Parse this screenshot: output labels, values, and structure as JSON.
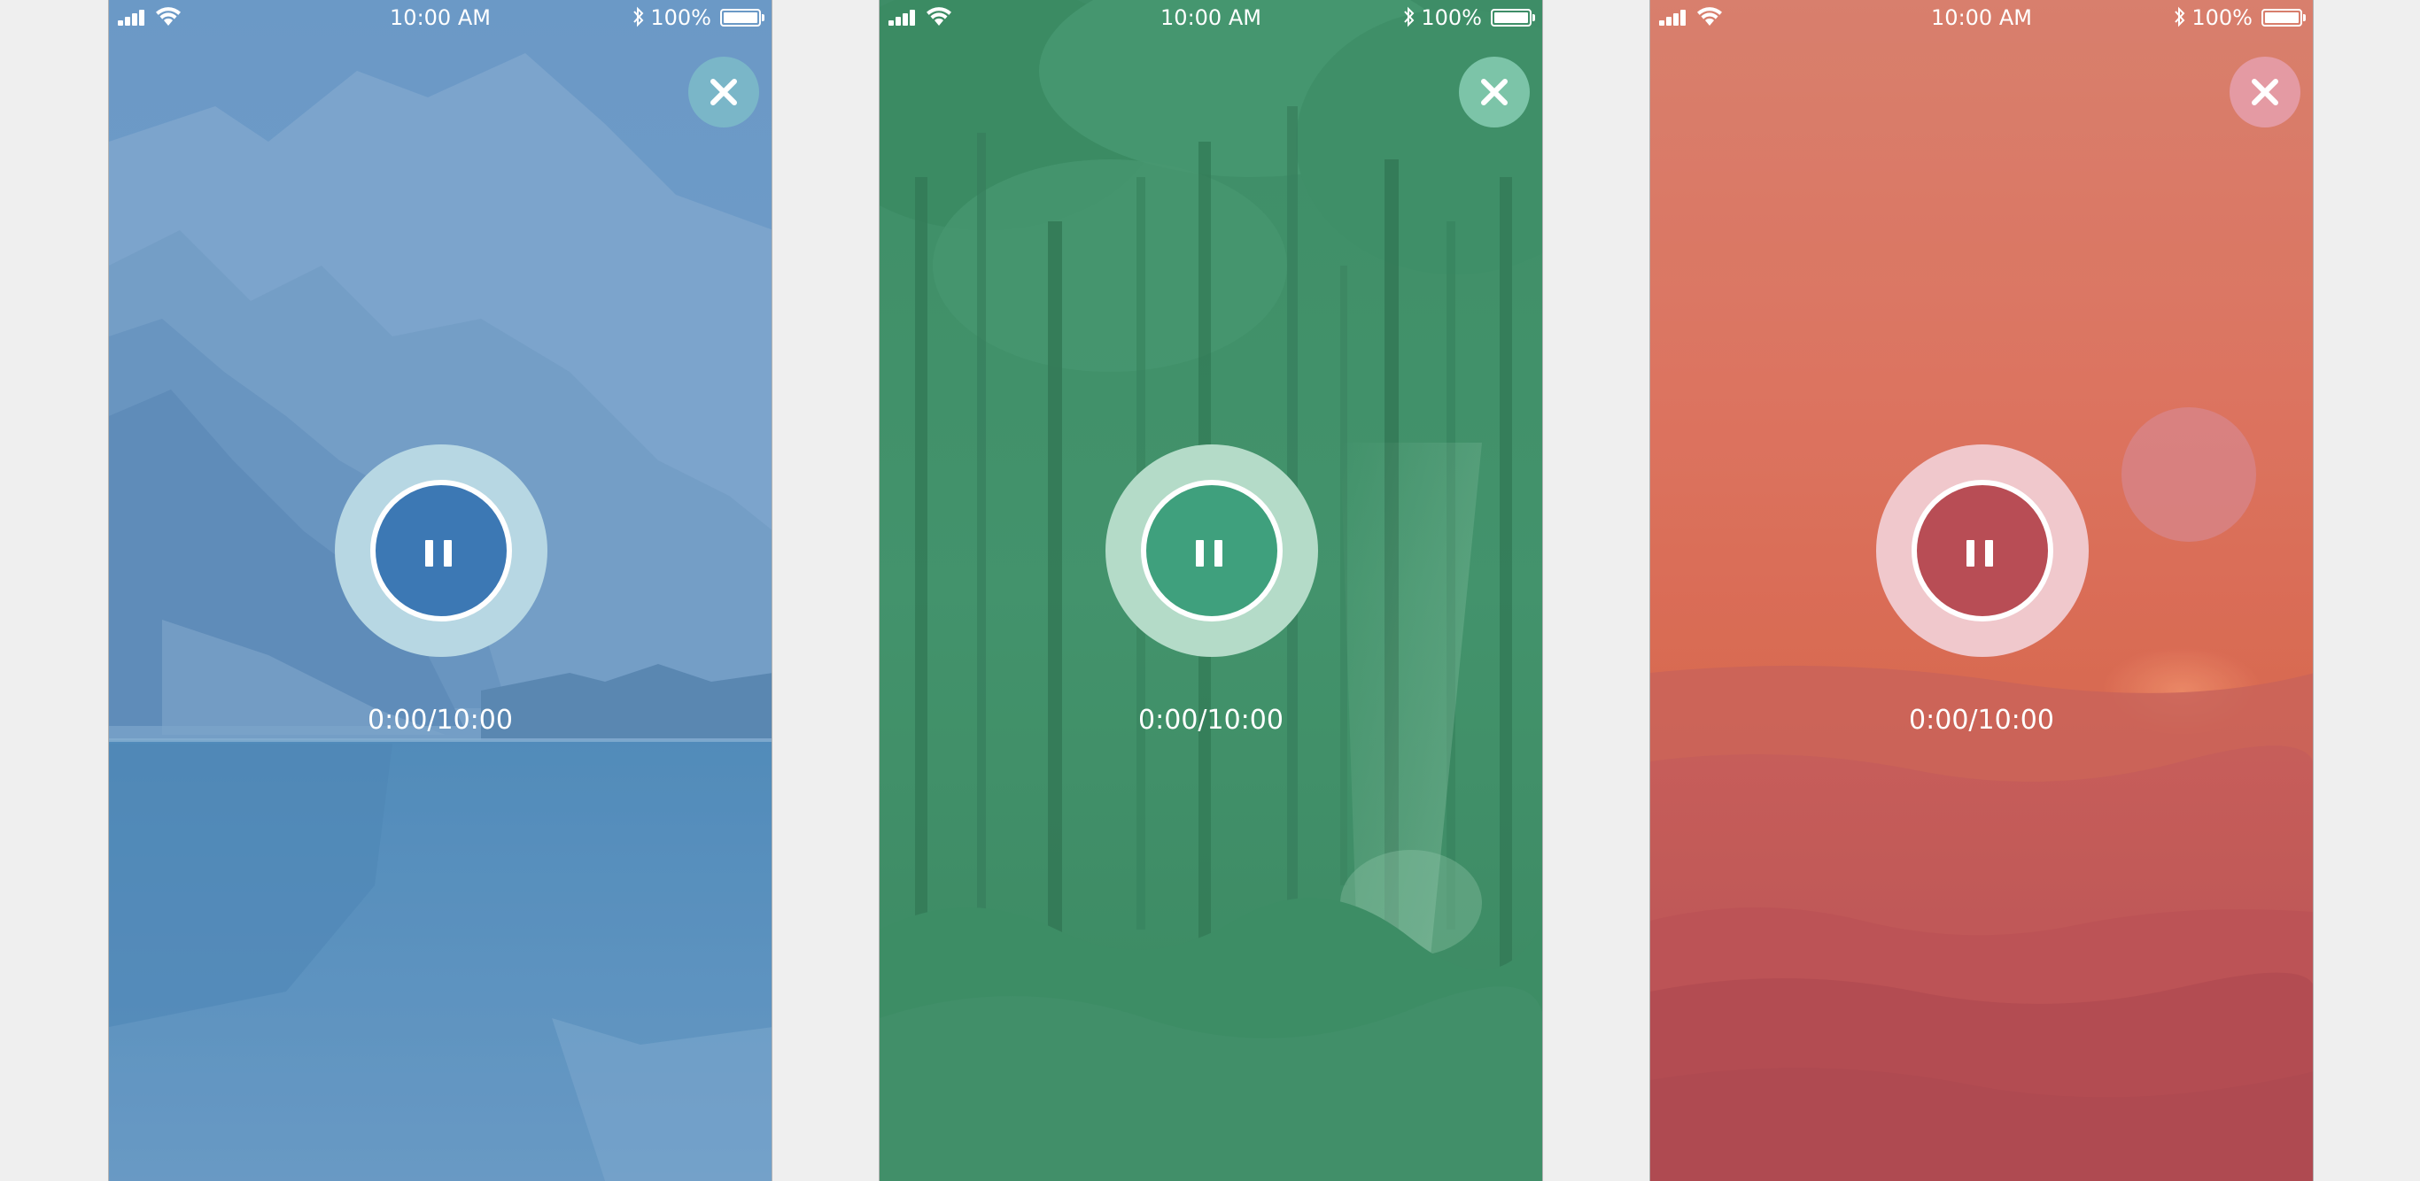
{
  "screens": [
    {
      "theme": "blue",
      "status": {
        "time": "10:00 AM",
        "battery": "100%"
      },
      "close_icon": "close-icon",
      "pause_icon": "pause-icon",
      "timer": "0:00/10:00",
      "colors": {
        "overlay": "#5f8fbf",
        "ring": "#b7d7e3",
        "core": "#3c78b4",
        "close_bg": "#7ab6c8"
      }
    },
    {
      "theme": "green",
      "status": {
        "time": "10:00 AM",
        "battery": "100%"
      },
      "close_icon": "close-icon",
      "pause_icon": "pause-icon",
      "timer": "0:00/10:00",
      "colors": {
        "overlay": "#3f8f6a",
        "ring": "#b4dbc8",
        "core": "#3fa07d",
        "close_bg": "#7cc4a8"
      }
    },
    {
      "theme": "red",
      "status": {
        "time": "10:00 AM",
        "battery": "100%"
      },
      "close_icon": "close-icon",
      "pause_icon": "pause-icon",
      "timer": "0:00/10:00",
      "colors": {
        "overlay": "#d9705e",
        "ring": "#f0c8cc",
        "core": "#b84d55",
        "close_bg": "#e49aa3"
      }
    }
  ]
}
